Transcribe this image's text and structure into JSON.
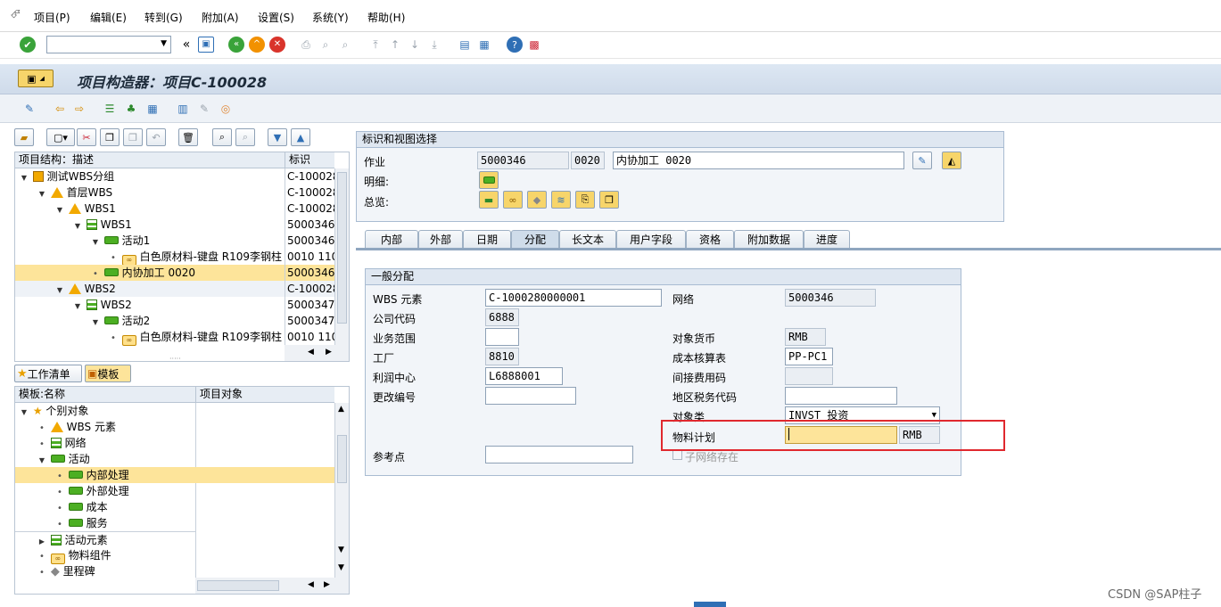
{
  "menu": [
    "项目(P)",
    "编辑(E)",
    "转到(G)",
    "附加(A)",
    "设置(S)",
    "系统(Y)",
    "帮助(H)"
  ],
  "title": "项目构造器：项目C-100028",
  "tree_header": {
    "col1": "项目结构：描述",
    "col2": "标识"
  },
  "tree_rows": [
    {
      "label": "测试WBS分组",
      "id": "C-100028"
    },
    {
      "label": "首层WBS",
      "id": "C-100028"
    },
    {
      "label": "WBS1",
      "id": "C-100028"
    },
    {
      "label": "WBS1",
      "id": "5000346"
    },
    {
      "label": "活动1",
      "id": "5000346"
    },
    {
      "label": "白色原材料-键盘 R109李钢柱",
      "id": "0010 110"
    },
    {
      "label": "内协加工 0020",
      "id": "5000346"
    },
    {
      "label": "WBS2",
      "id": "C-100028"
    },
    {
      "label": "WBS2",
      "id": "5000347"
    },
    {
      "label": "活动2",
      "id": "5000347"
    },
    {
      "label": "白色原材料-键盘 R109李钢柱",
      "id": "0010 110"
    }
  ],
  "pane_tabs": {
    "worklist": "工作清单",
    "template": "模板"
  },
  "template_header": {
    "col1": "模板:名称",
    "col2": "项目对象"
  },
  "template_rows": [
    "个别对象",
    "WBS 元素",
    "网络",
    "活动",
    "内部处理",
    "外部处理",
    "成本",
    "服务",
    "活动元素",
    "物料组件",
    "里程碑"
  ],
  "ident": {
    "header": "标识和视图选择",
    "operation_label": "作业",
    "operation_network": "5000346",
    "operation_no": "0020",
    "operation_desc": "内协加工 0020",
    "detail_label": "明细:",
    "overview_label": "总览:"
  },
  "tabs": [
    "内部",
    "外部",
    "日期",
    "分配",
    "长文本",
    "用户字段",
    "资格",
    "附加数据",
    "进度"
  ],
  "active_tab": "分配",
  "assign": {
    "header": "一般分配",
    "wbs_label": "WBS 元素",
    "wbs_value": "C-1000280000001",
    "network_label": "网络",
    "network_value": "5000346",
    "company_label": "公司代码",
    "company_value": "6888",
    "business_area_label": "业务范围",
    "business_area_value": "",
    "currency_label": "对象货币",
    "currency_value": "RMB",
    "plant_label": "工厂",
    "plant_value": "8810",
    "costing_label": "成本核算表",
    "costing_value": "PP-PC1",
    "profit_label": "利润中心",
    "profit_value": "L6888001",
    "overhead_label": "间接费用码",
    "overhead_value": "",
    "change_label": "更改编号",
    "change_value": "",
    "tax_label": "地区税务代码",
    "tax_value": "",
    "objclass_label": "对象类",
    "objclass_value": "INVST 投资",
    "matplan_label": "物料计划",
    "matplan_value": "",
    "matplan_currency": "RMB",
    "ref_label": "参考点",
    "ref_value": "",
    "subnet_label": "子网络存在"
  },
  "watermark": "CSDN @SAP柱子",
  "colors": {
    "highlight": "#e0282e",
    "selection": "#fde49a",
    "title_bg": "#cfdbea"
  }
}
